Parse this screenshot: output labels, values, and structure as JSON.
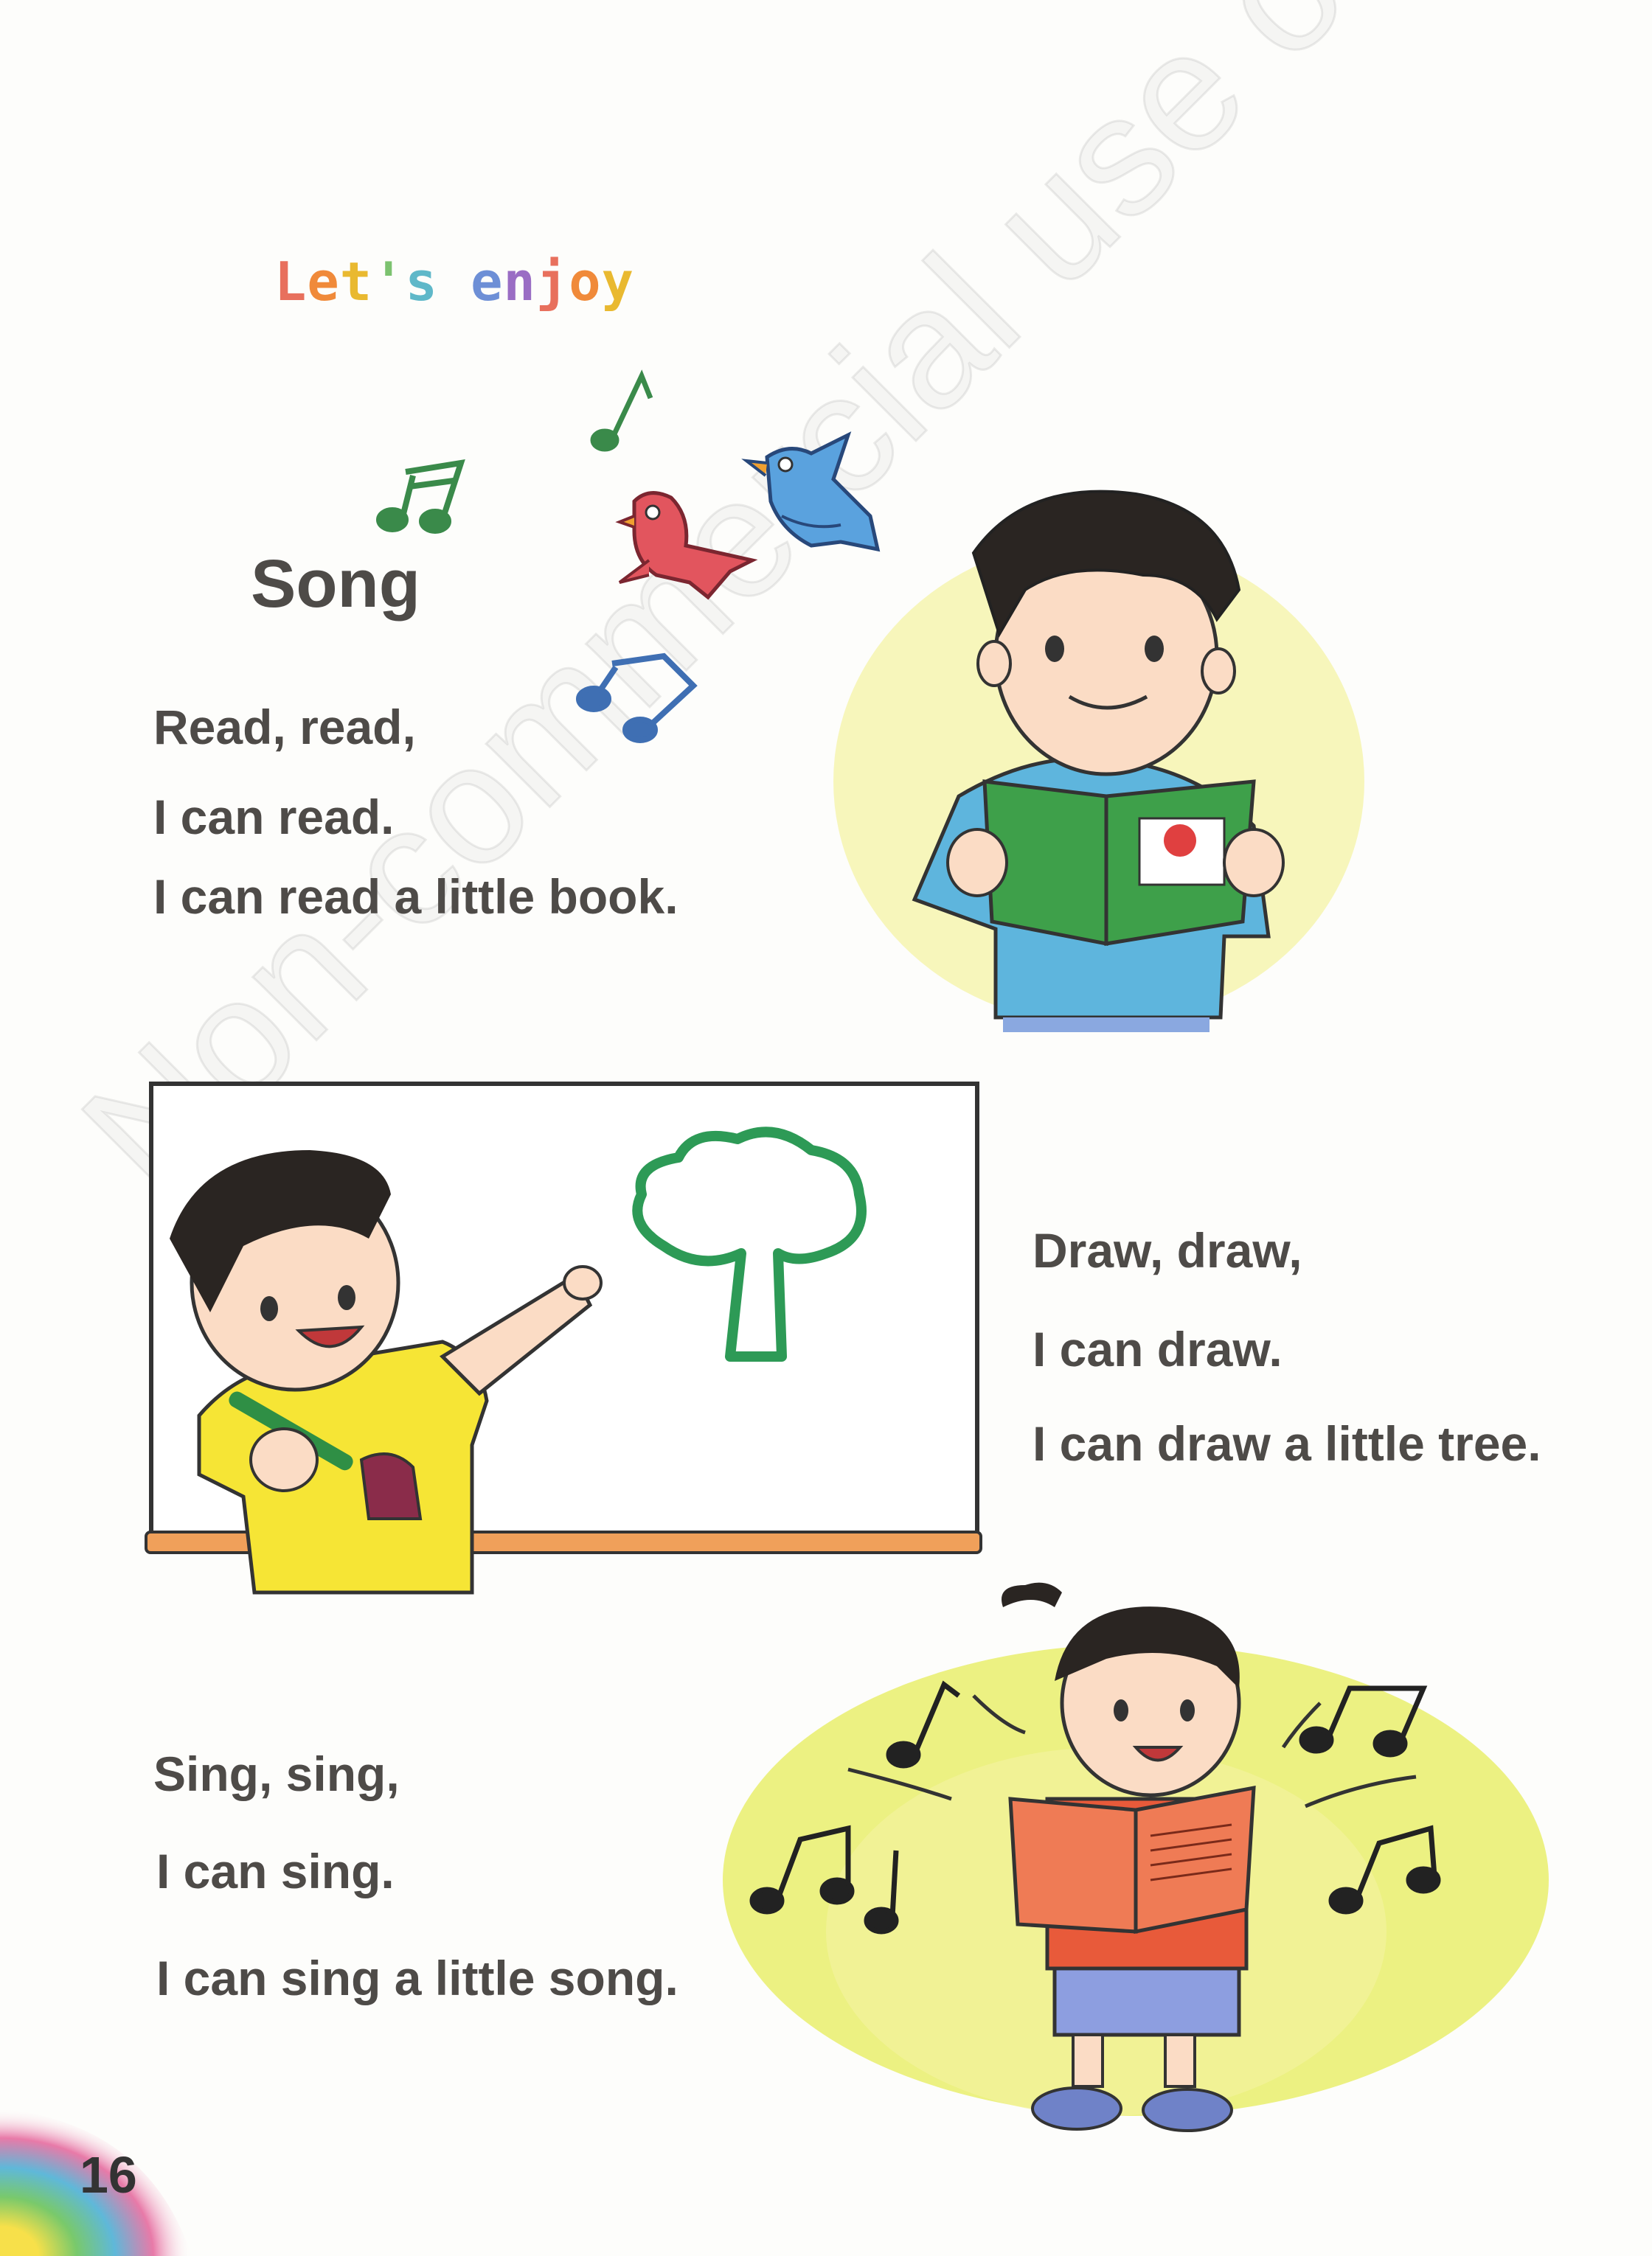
{
  "section_title": "Let's enjoy",
  "heading": "Song",
  "verse1": [
    "Read, read,",
    "I can read.",
    "I can read a little book."
  ],
  "verse2": [
    "Draw, draw,",
    "I can draw.",
    "I can draw a little tree."
  ],
  "verse3": [
    "Sing, sing,",
    "I can sing.",
    "I can sing a little song."
  ],
  "page_number": "16",
  "watermark": "Non-commercial use only",
  "colors": {
    "text": "#4e4b48",
    "title_rainbow": [
      "#e8705d",
      "#f08a3a",
      "#e9b930",
      "#7cc26f",
      "#5fb8c9",
      "#6d8fd6",
      "#9a6dc4"
    ]
  }
}
